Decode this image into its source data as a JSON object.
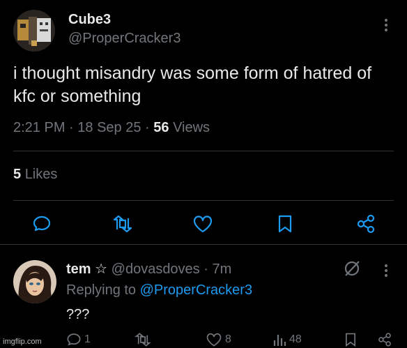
{
  "post": {
    "display_name": "Cube3",
    "handle": "@ProperCracker3",
    "text": "i thought misandry was some form of hatred of kfc or something",
    "time": "2:21 PM",
    "date": "18 Sep 25",
    "views_count": "56",
    "views_label": "Views",
    "likes_count": "5",
    "likes_label": "Likes",
    "actions": [
      "reply-icon",
      "retweet-icon",
      "like-icon",
      "bookmark-icon",
      "share-icon"
    ]
  },
  "reply": {
    "display_name": "tem",
    "badge": "☆",
    "handle": "@dovasdoves",
    "age": "7m",
    "replying_prefix": "Replying to",
    "replying_to": "@ProperCracker3",
    "text": "???",
    "reply_count": "1",
    "retweet_count": "",
    "like_count": "8",
    "view_count": "48"
  },
  "watermark": "imgflip.com",
  "colors": {
    "background": "#000000",
    "text_primary": "#e7e9ea",
    "text_secondary": "#71767b",
    "accent": "#1d9bf0",
    "divider": "#2f3336"
  }
}
